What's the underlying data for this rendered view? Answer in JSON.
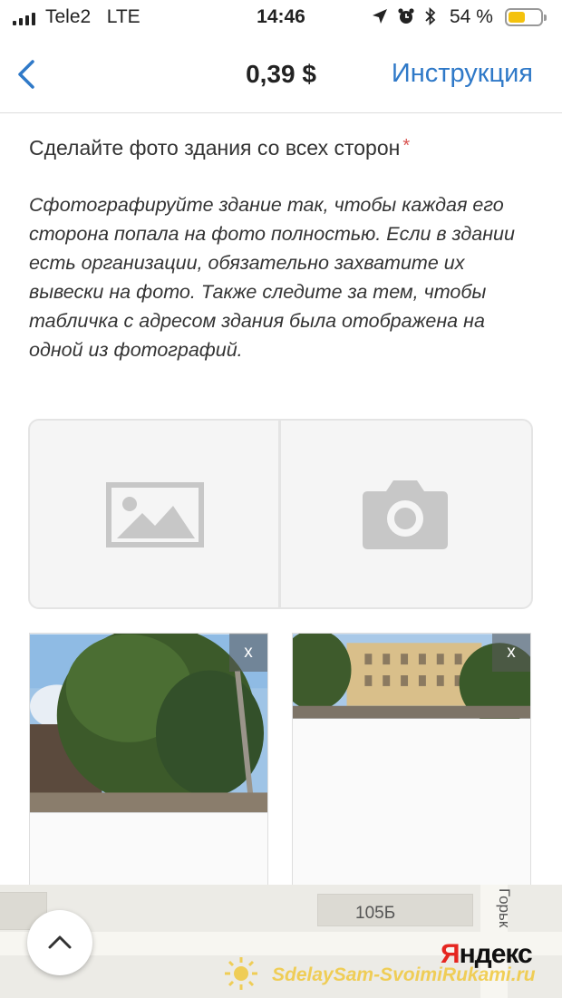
{
  "status_bar": {
    "carrier": "Tele2",
    "network": "LTE",
    "time": "14:46",
    "battery_percent": "54 %",
    "battery_level": 0.54
  },
  "nav": {
    "back_icon": "chevron-left-icon",
    "price": "0,39 $",
    "instruction_link": "Инструкция",
    "accent_color": "#2f79c8"
  },
  "task": {
    "heading": "Сделайте фото здания со всех сторон",
    "required_mark": "*",
    "description": "Сфотографируйте здание так, чтобы каждая его сторона попала на фото полностью. Если в здании есть организации, обязательно захватите их вывески на фото. Также следите за тем, чтобы табличка с адресом здания была отображена на одной из фотографий."
  },
  "upload": {
    "gallery_icon": "image-gallery-icon",
    "camera_icon": "camera-icon"
  },
  "photos": [
    {
      "close_label": "x"
    },
    {
      "close_label": "x"
    }
  ],
  "map": {
    "house_number": "105Б",
    "street": "Горьк",
    "brand": "Яндекс",
    "expand_icon": "chevron-up-icon"
  },
  "watermark": "SdelaySam-SvoimiRukami.ru"
}
